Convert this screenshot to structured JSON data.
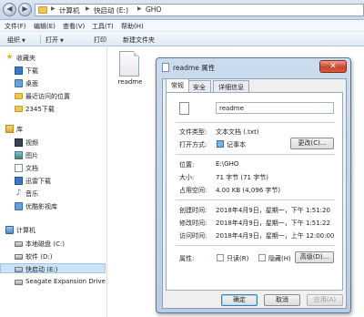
{
  "address": {
    "crumbs": [
      "计算机",
      "快启动 (E:)",
      "GHO"
    ]
  },
  "menu": [
    "文件(F)",
    "编辑(E)",
    "查看(V)",
    "工具(T)",
    "帮助(H)"
  ],
  "commands": {
    "organize": "组织",
    "open": "打开",
    "print": "打印",
    "new_folder": "新建文件夹"
  },
  "sidebar": {
    "favorites": {
      "header": "收藏夹",
      "items": [
        "下载",
        "桌面",
        "最近访问的位置",
        "2345下载"
      ]
    },
    "libraries": {
      "header": "库",
      "items": [
        "视频",
        "图片",
        "文档",
        "迅雷下载",
        "音乐",
        "优酷影视库"
      ]
    },
    "computer": {
      "header": "计算机",
      "items": [
        "本地磁盘 (C:)",
        "软件 (D:)",
        "快启动 (E:)",
        "Seagate Expansion Drive"
      ]
    }
  },
  "content": {
    "file_name": "readme"
  },
  "dialog": {
    "title": "readme 属性",
    "close_glyph": "✕",
    "tabs": [
      "常规",
      "安全",
      "详细信息"
    ],
    "file_name": "readme",
    "props": {
      "type_label": "文件类型:",
      "type_value": "文本文档 (.txt)",
      "open_label": "打开方式:",
      "open_value": "记事本",
      "change_btn": "更改(C)...",
      "location_label": "位置:",
      "location_value": "E:\\GHO",
      "size_label": "大小:",
      "size_value": "71 字节 (71 字节)",
      "disk_label": "占用空间:",
      "disk_value": "4.00 KB (4,096 字节)",
      "created_label": "创建时间:",
      "created_value": "2018年4月9日，星期一，下午 1:51:20",
      "modified_label": "修改时间:",
      "modified_value": "2018年4月9日，星期一，下午 1:51:22",
      "accessed_label": "访问时间:",
      "accessed_value": "2018年4月9日，星期一，上午 12:00:00",
      "attr_label": "属性:",
      "readonly": "只读(R)",
      "hidden": "隐藏(H)",
      "advanced_btn": "高级(D)..."
    },
    "buttons": {
      "ok": "确定",
      "cancel": "取消",
      "apply": "应用(A)"
    }
  }
}
